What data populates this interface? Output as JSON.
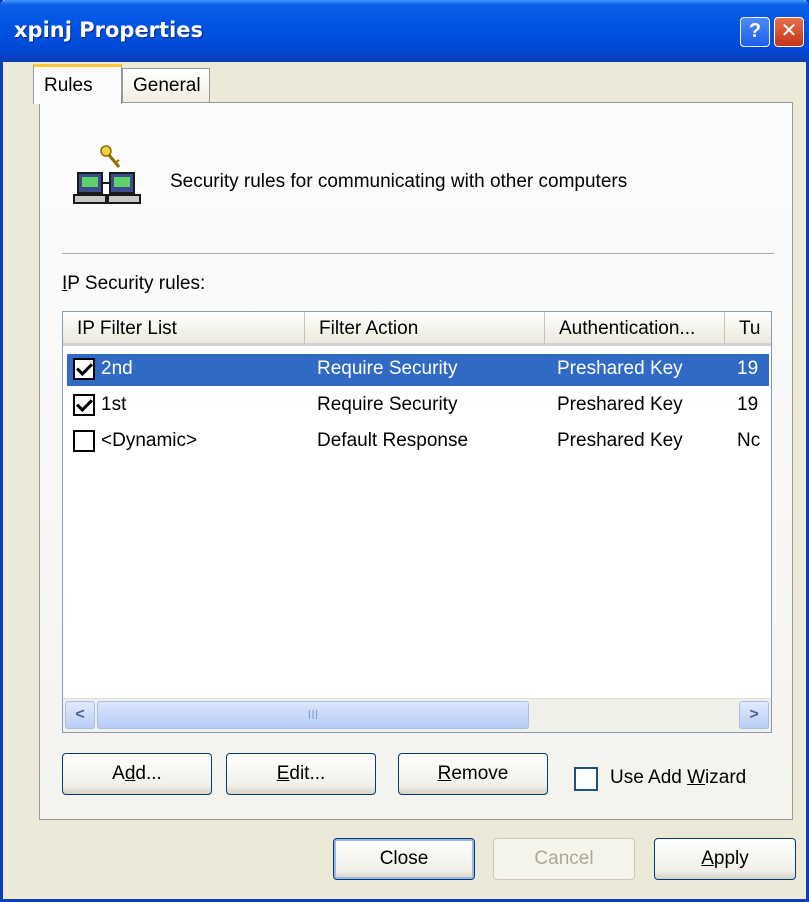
{
  "window": {
    "title": "xpinj Properties",
    "help_glyph": "?",
    "close_glyph": "✕"
  },
  "tabs": [
    {
      "label": "Rules",
      "active": true
    },
    {
      "label": "General",
      "active": false
    }
  ],
  "header": {
    "text": "Security rules for communicating with other computers"
  },
  "rules": {
    "label_accel": "I",
    "label_rest": "P Security rules:",
    "columns": [
      "IP Filter List",
      "Filter Action",
      "Authentication...",
      "Tu"
    ],
    "rows": [
      {
        "checked": true,
        "name": "2nd",
        "action": "Require Security",
        "auth": "Preshared Key",
        "tunnel": "19",
        "selected": true
      },
      {
        "checked": true,
        "name": "1st",
        "action": "Require Security",
        "auth": "Preshared Key",
        "tunnel": "19",
        "selected": false
      },
      {
        "checked": false,
        "name": "<Dynamic>",
        "action": "Default Response",
        "auth": "Preshared Key",
        "tunnel": "Nc",
        "selected": false
      }
    ],
    "scroll_thumb_grip": "III"
  },
  "buttons": {
    "add_pre": "A",
    "add_accel": "d",
    "add_post": "d...",
    "edit_accel": "E",
    "edit_post": "dit...",
    "remove_accel": "R",
    "remove_post": "emove",
    "wizard_pre": "Use Add ",
    "wizard_accel": "W",
    "wizard_post": "izard",
    "wizard_checked": false,
    "close": "Close",
    "cancel": "Cancel",
    "apply_accel": "A",
    "apply_post": "pply"
  },
  "colors": {
    "selection": "#316ac5",
    "titlebar": "#0054e3",
    "dialog_bg": "#ece9d8"
  }
}
